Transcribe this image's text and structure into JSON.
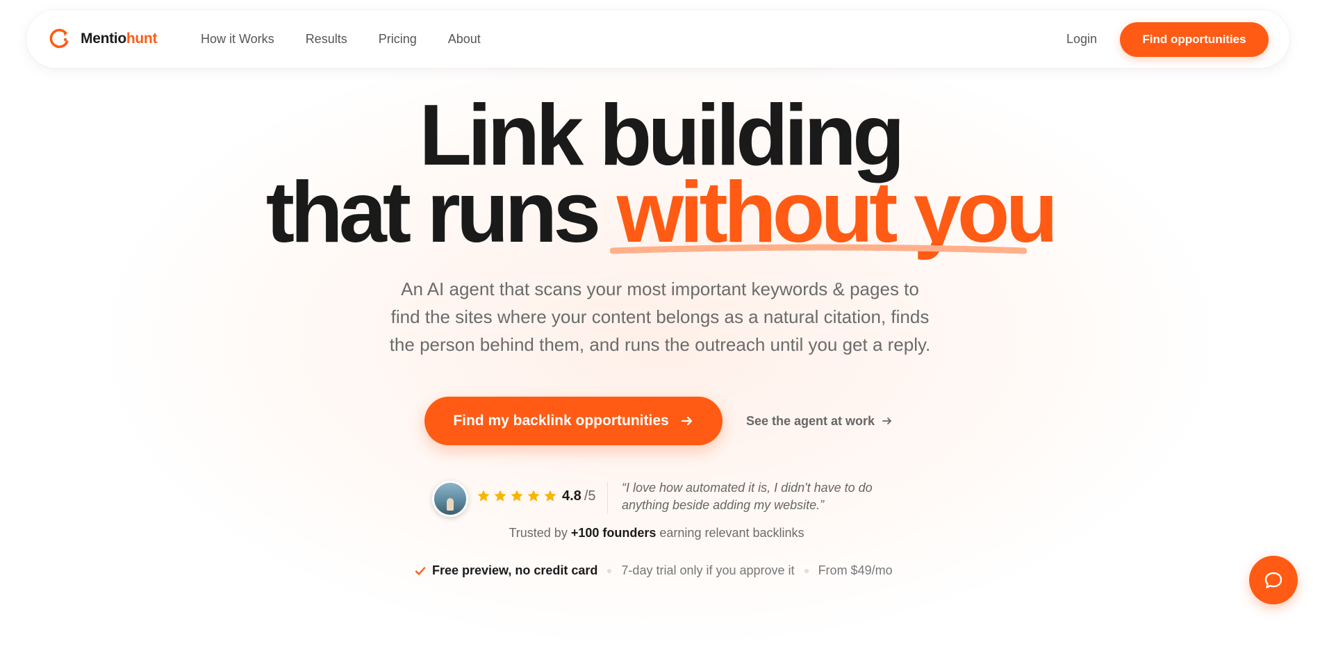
{
  "brand": {
    "name_part1": "Mentio",
    "name_part2": "hunt",
    "accent_color": "#ff5b14"
  },
  "nav": {
    "links": [
      "How it Works",
      "Results",
      "Pricing",
      "About"
    ],
    "login_label": "Login",
    "cta_label": "Find opportunities"
  },
  "hero": {
    "title_line1": "Link building",
    "title_line2_plain": "that runs",
    "title_line2_accent": "without you",
    "subtitle_line1": "An AI agent that scans your most important keywords & pages to",
    "subtitle_line2": "find the sites where your content belongs as a natural citation, finds",
    "subtitle_line3": "the person behind them, and runs the outreach until you get a reply.",
    "primary_cta": "Find my backlink opportunities",
    "secondary_cta": "See the agent at work"
  },
  "social_proof": {
    "stars": 5,
    "rating": "4.8",
    "rating_scale": "/5",
    "quote_line1": "“I love how automated it is, I didn't have to do",
    "quote_line2": "anything beside adding my website.”",
    "trusted_prefix": "Trusted by",
    "trusted_bold": "+100 founders",
    "trusted_suffix": "earning relevant backlinks"
  },
  "features": [
    "Free preview, no credit card",
    "7-day trial only if you approve it",
    "From $49/mo"
  ],
  "icons": {
    "logo": "mentiohunt-logo-icon",
    "star": "star-icon",
    "arrow": "arrow-right-icon",
    "check": "check-icon",
    "chat": "chat-bubble-icon"
  },
  "colors": {
    "star": "#f7b500",
    "text_dark": "#1a1a1a",
    "text_muted": "#6b6b6b"
  }
}
